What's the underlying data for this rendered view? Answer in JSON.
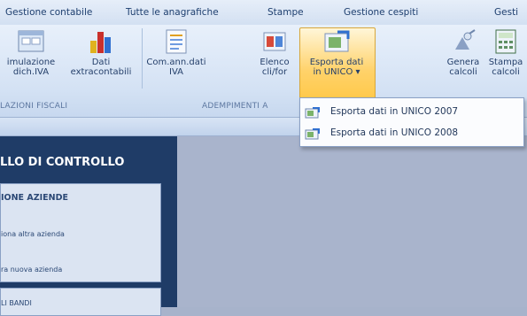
{
  "tabs": [
    "Gestione contabile",
    "Tutte le anagrafiche",
    "Stampe",
    "Gestione cespiti",
    "Gesti"
  ],
  "ribbon": {
    "group1": {
      "label": "LAZIONI FISCALI",
      "buttons": [
        {
          "line1": "imulazione",
          "line2": "dich.IVA"
        },
        {
          "line1": "Dati",
          "line2": "extracontabili"
        }
      ]
    },
    "group2": {
      "label": "ADEMPIMENTI A",
      "buttons": [
        {
          "line1": "Com.ann.dati",
          "line2": "IVA"
        },
        {
          "line1": "Elenco",
          "line2": "cli/for"
        },
        {
          "line1": "Esporta dati",
          "line2": "in UNICO ▾"
        }
      ]
    },
    "group3": {
      "buttons": [
        {
          "line1": "Genera",
          "line2": "calcoli"
        },
        {
          "line1": "Stampa",
          "line2": "calcoli"
        }
      ]
    }
  },
  "dropdown": {
    "items": [
      "Esporta dati in UNICO 2007",
      "Esporta dati in UNICO 2008"
    ]
  },
  "control": {
    "title": "LLO DI CONTROLLO",
    "box_title": "IONE AZIENDE",
    "links": [
      "iona altra azienda",
      "ra nuova azienda"
    ],
    "box2_title": "LI BANDI"
  },
  "colors": {
    "accent": "#ffc94a",
    "panel": "#1f3c67",
    "workspace": "#a9b4cc"
  }
}
